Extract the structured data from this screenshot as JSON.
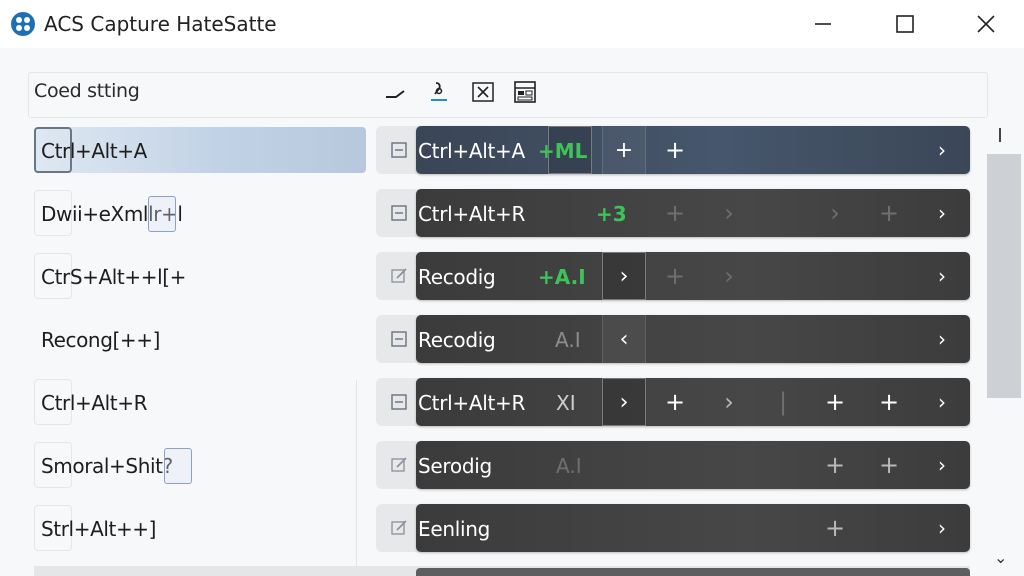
{
  "window": {
    "title": "ACS Capture HateSatte",
    "accent": "#1f6fb5"
  },
  "toolbar": {
    "section_label": "Coed stting",
    "tools": [
      "check-icon",
      "edit-pen-icon",
      "delete-box-icon",
      "grid-settings-icon"
    ]
  },
  "colors": {
    "selected_row": "#c2d2e6",
    "dark_bar": "#444444",
    "active_bar": "#46566c",
    "green_text": "#3fc25a"
  },
  "rows": [
    {
      "shortcut": "Ctrl+Alt+A",
      "action": "Ctrl+Alt+A",
      "tag": "+ML",
      "selected": true,
      "status_icon": "list-icon"
    },
    {
      "shortcut": "Dwii+eXmllr+l",
      "action": "Ctrl+Alt+R",
      "tag": "+3",
      "selected": false,
      "status_icon": "list-icon"
    },
    {
      "shortcut": "CtrS+Alt++l[+",
      "action": "Recodig",
      "tag": "+A.I",
      "selected": false,
      "status_icon": "edit-icon"
    },
    {
      "shortcut": "Recong[++]",
      "action": "Recodig",
      "tag": "A.I",
      "selected": false,
      "status_icon": "list-icon"
    },
    {
      "shortcut": "Ctrl+Alt+R",
      "action": "Ctrl+Alt+R",
      "tag": "XI",
      "selected": false,
      "status_icon": "list-icon"
    },
    {
      "shortcut": "Smoral+Shit?",
      "action": "Serodig",
      "tag": "A.I",
      "selected": false,
      "status_icon": "edit-icon"
    },
    {
      "shortcut": "Strl+Alt++]",
      "action": "Eenling",
      "tag": "",
      "selected": false,
      "status_icon": "edit-icon"
    }
  ],
  "glyphs": {
    "plus": "+",
    "right": "›",
    "left": "‹",
    "bar": "|"
  }
}
